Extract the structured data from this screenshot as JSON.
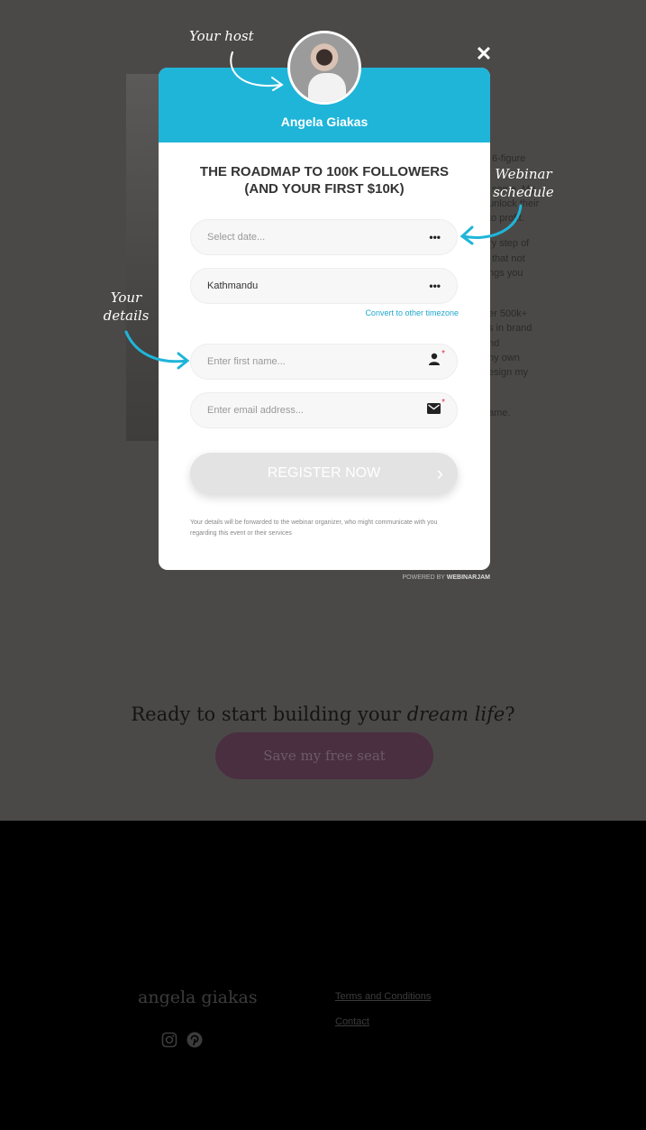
{
  "background_text": [
    "6-figure",
    "same. My",
    "unlock their",
    "to profit.",
    "ry step of",
    "that not",
    "ngs you",
    "er 500k+",
    "s in brand",
    "nd",
    "ny own",
    "esign my",
    "ame."
  ],
  "annotations": {
    "host": "Your host",
    "schedule": "Webinar schedule",
    "details": "Your details"
  },
  "modal": {
    "host_name": "Angela Giakas",
    "title_line1": "THE ROADMAP TO 100K FOLLOWERS",
    "title_line2": "(AND YOUR FIRST $10K)",
    "date_placeholder": "Select date...",
    "timezone_value": "Kathmandu",
    "timezone_link": "Convert to other timezone",
    "first_name_placeholder": "Enter first name...",
    "email_placeholder": "Enter email address...",
    "required_mark": "*",
    "more_glyph": "•••",
    "register_label": "REGISTER NOW",
    "disclaimer": "Your details will be forwarded to the webinar organizer, who might communicate with you regarding this event or their services",
    "powered_by": "POWERED BY",
    "powered_brand": "WEBINARJAM",
    "close": "✕"
  },
  "cta": {
    "text": "Ready to start building your ",
    "italic": "dream life",
    "end": "?",
    "button": "Save my free seat"
  },
  "footer": {
    "logo": "angela giakas",
    "links": [
      "Terms and Conditions",
      "Contact"
    ]
  },
  "colors": {
    "accent": "#1fb5d9",
    "overlay": "#4a4948"
  }
}
